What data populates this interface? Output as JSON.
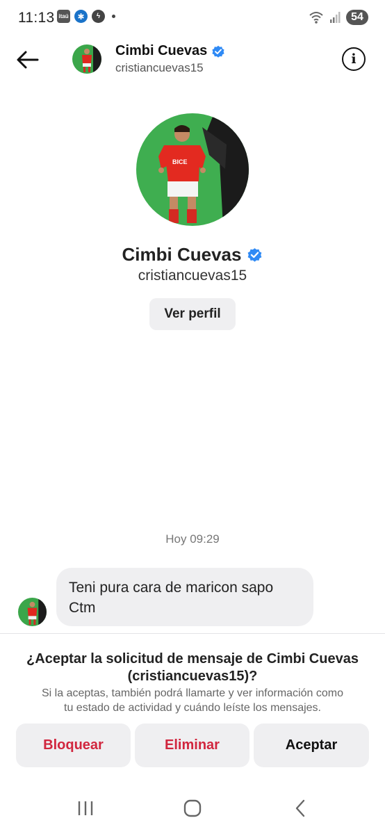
{
  "status_bar": {
    "time": "11:13",
    "app_icons": [
      {
        "icon": "itau-icon",
        "text": "itaú"
      },
      {
        "icon": "walmart-icon",
        "text": "✱"
      },
      {
        "icon": "messenger-icon",
        "text": "ϟ"
      }
    ],
    "battery": "54"
  },
  "header": {
    "name": "Cimbi Cuevas",
    "username": "cristiancuevas15"
  },
  "profile": {
    "name": "Cimbi Cuevas",
    "username": "cristiancuevas15",
    "jersey_text": "BICE",
    "view_profile_label": "Ver perfil"
  },
  "conversation": {
    "timestamp": "Hoy 09:29",
    "messages": [
      {
        "text_line1": "Teni pura cara de maricon sapo",
        "text_line2": "Ctm"
      }
    ]
  },
  "request": {
    "title_line1": "¿Aceptar la solicitud de mensaje de Cimbi Cuevas",
    "title_line2": "(cristiancuevas15)?",
    "desc_line1": "Si la aceptas, también podrá llamarte y ver información como",
    "desc_line2": "tu estado de actividad y cuándo leíste los mensajes.",
    "block_label": "Bloquear",
    "delete_label": "Eliminar",
    "accept_label": "Aceptar"
  },
  "colors": {
    "accent_red": "#d1263e",
    "verified_blue": "#2f8af5",
    "button_bg": "#efeff1"
  }
}
